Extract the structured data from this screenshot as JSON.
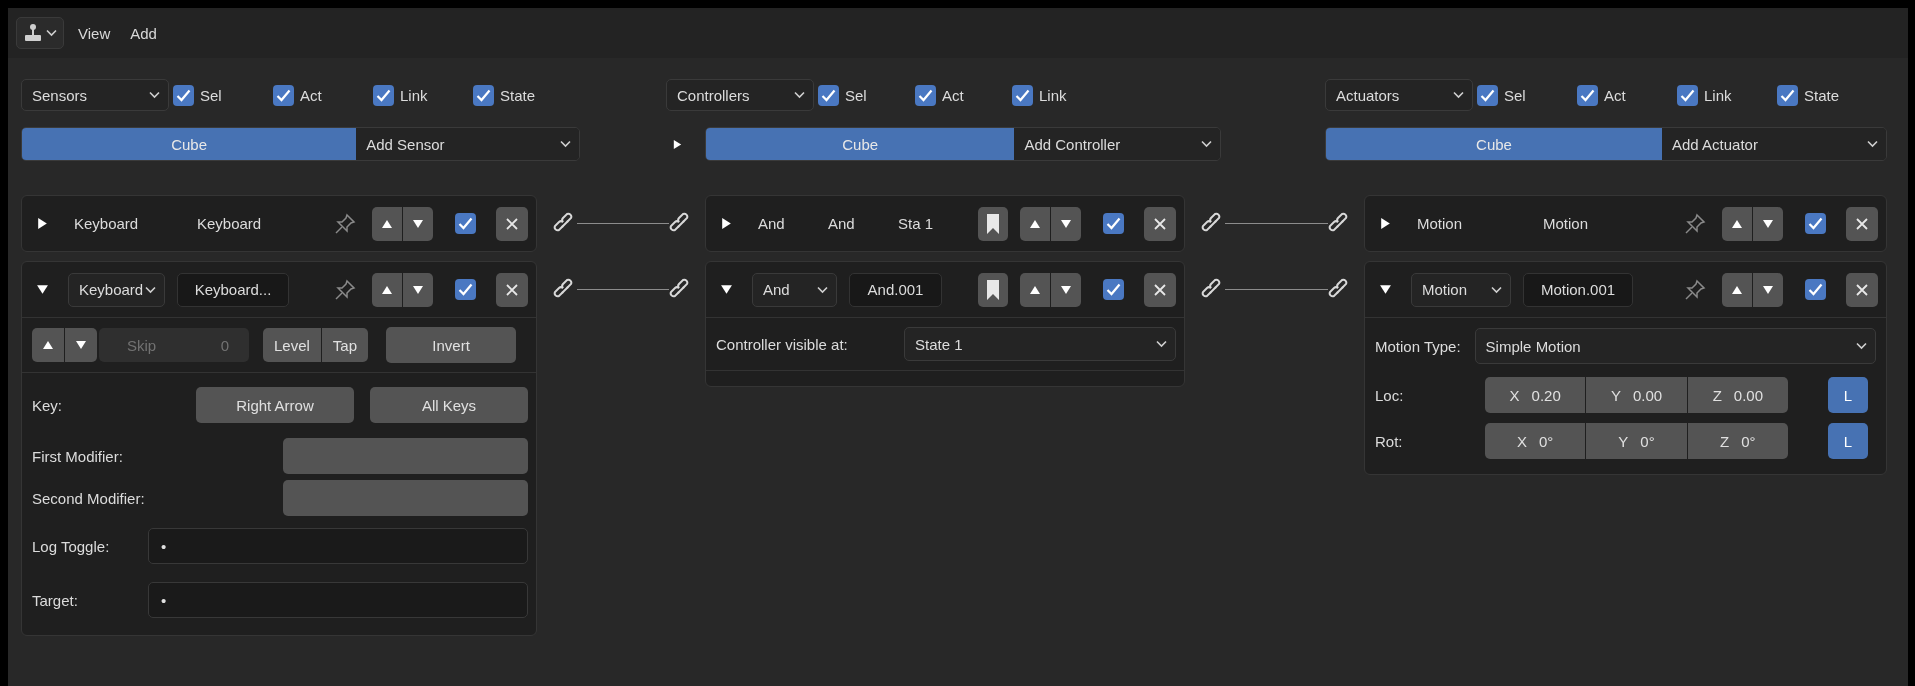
{
  "toolbar": {
    "menus": [
      "View",
      "Add"
    ]
  },
  "columns": [
    {
      "kind": "sensors",
      "dropdown": "Sensors",
      "filters": [
        {
          "label": "Sel",
          "checked": true
        },
        {
          "label": "Act",
          "checked": true
        },
        {
          "label": "Link",
          "checked": true
        },
        {
          "label": "State",
          "checked": true
        }
      ],
      "object": {
        "label": "Cube",
        "selected": true
      },
      "add": "Add Sensor",
      "bricks": [
        {
          "expanded": false,
          "type": "Keyboard",
          "name": "Keyboard",
          "active": true
        },
        {
          "expanded": true,
          "type": "Keyboard",
          "name": "Keyboard...",
          "active": true,
          "body": {
            "kind": "keyboard",
            "skip": {
              "label": "Skip",
              "value": "0",
              "disabled": true
            },
            "toggles": [
              {
                "label": "Level",
                "on": false
              },
              {
                "label": "Tap",
                "on": false
              }
            ],
            "invert": {
              "label": "Invert",
              "on": false
            },
            "rows": [
              {
                "kind": "keys",
                "label": "Key:",
                "buttons": [
                  "Right Arrow",
                  "All Keys"
                ]
              },
              {
                "kind": "modifier",
                "label": "First Modifier:"
              },
              {
                "kind": "modifier",
                "label": "Second Modifier:"
              },
              {
                "kind": "object",
                "label": "Log Toggle:",
                "value": "•"
              },
              {
                "kind": "object",
                "label": "Target:",
                "value": "•"
              }
            ]
          }
        }
      ]
    },
    {
      "kind": "controllers",
      "dropdown": "Controllers",
      "filters": [
        {
          "label": "Sel",
          "checked": true
        },
        {
          "label": "Act",
          "checked": true
        },
        {
          "label": "Link",
          "checked": true
        }
      ],
      "state_panel": {
        "expanded": false
      },
      "object": {
        "label": "Cube",
        "selected": true
      },
      "add": "Add Controller",
      "bricks": [
        {
          "expanded": false,
          "type": "And",
          "name": "And",
          "state": "Sta 1",
          "active": true
        },
        {
          "expanded": true,
          "type": "And",
          "name": "And.001",
          "active": true,
          "body": {
            "kind": "controller",
            "label": "Controller visible at:",
            "value": "State 1"
          }
        }
      ]
    },
    {
      "kind": "actuators",
      "dropdown": "Actuators",
      "filters": [
        {
          "label": "Sel",
          "checked": true
        },
        {
          "label": "Act",
          "checked": true
        },
        {
          "label": "Link",
          "checked": true
        },
        {
          "label": "State",
          "checked": true
        }
      ],
      "object": {
        "label": "Cube",
        "selected": true
      },
      "add": "Add Actuator",
      "bricks": [
        {
          "expanded": false,
          "type": "Motion",
          "name": "Motion",
          "active": true
        },
        {
          "expanded": true,
          "type": "Motion",
          "name": "Motion.001",
          "active": true,
          "body": {
            "kind": "motion",
            "type_label": "Motion Type:",
            "type_value": "Simple Motion",
            "vectors": [
              {
                "label": "Loc:",
                "axes": [
                  {
                    "axis": "X",
                    "value": "0.20"
                  },
                  {
                    "axis": "Y",
                    "value": "0.00"
                  },
                  {
                    "axis": "Z",
                    "value": "0.00"
                  }
                ],
                "local": {
                  "label": "L",
                  "on": true
                }
              },
              {
                "label": "Rot:",
                "axes": [
                  {
                    "axis": "X",
                    "value": "0°"
                  },
                  {
                    "axis": "Y",
                    "value": "0°"
                  },
                  {
                    "axis": "Z",
                    "value": "0°"
                  }
                ],
                "local": {
                  "label": "L",
                  "on": true
                }
              }
            ]
          }
        }
      ]
    }
  ]
}
